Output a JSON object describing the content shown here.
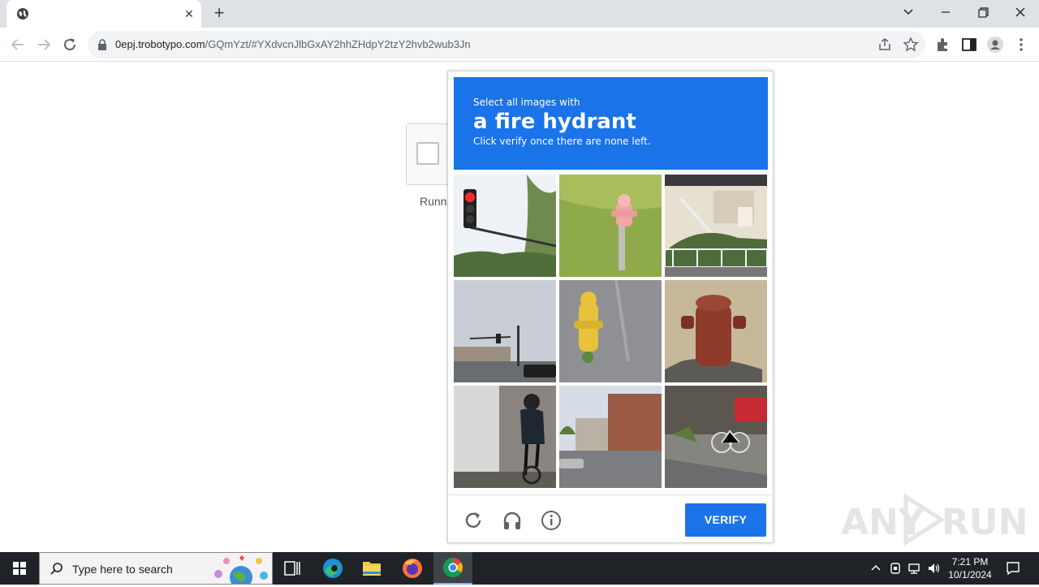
{
  "browser": {
    "tab_close": "✕",
    "new_tab": "+",
    "url_host": "0epj.trobotypo.com",
    "url_path": "/GQmYzt/#YXdvcnJlbGxAY2hhZHdpY2tzY2hvb2wub3Jn"
  },
  "page": {
    "running_text": "Runni"
  },
  "captcha": {
    "prompt_small": "Select all images with",
    "prompt_target": "a fire hydrant",
    "prompt_sub": "Click verify once there are none left.",
    "verify_label": "VERIFY",
    "header_color": "#1a73e8",
    "tiles": [
      {
        "icon": "traffic-light-image"
      },
      {
        "icon": "fire-hydrant-image"
      },
      {
        "icon": "building-stairs-image"
      },
      {
        "icon": "intersection-image"
      },
      {
        "icon": "fire-hydrant-image"
      },
      {
        "icon": "fire-hydrant-image"
      },
      {
        "icon": "cyclist-image"
      },
      {
        "icon": "street-image"
      },
      {
        "icon": "bicycle-image"
      }
    ]
  },
  "watermark": {
    "text_left": "ANY",
    "text_right": "RUN"
  },
  "taskbar": {
    "search_placeholder": "Type here to search",
    "time": "7:21 PM",
    "date": "10/1/2024"
  }
}
